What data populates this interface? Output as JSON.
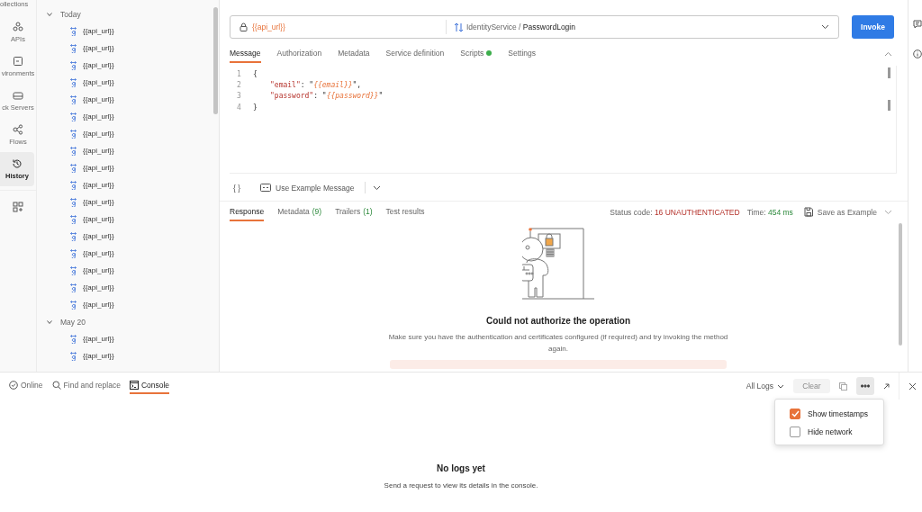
{
  "nav_rail": {
    "items": [
      {
        "label": "ollections",
        "kind": "cut",
        "selected": false
      },
      {
        "label": "APIs",
        "kind": "apis",
        "selected": false
      },
      {
        "label": "vironments",
        "kind": "environments",
        "selected": false
      },
      {
        "label": "ck Servers",
        "kind": "servers",
        "selected": false
      },
      {
        "label": "Flows",
        "kind": "flows",
        "selected": false
      },
      {
        "label": "History",
        "kind": "history",
        "selected": true
      },
      {
        "kind": "add",
        "selected": false
      }
    ]
  },
  "history": {
    "groups": [
      {
        "label": "Today",
        "expanded": true,
        "items": [
          {
            "label": "{{api_url}}"
          },
          {
            "label": "{{api_url}}"
          },
          {
            "label": "{{api_url}}"
          },
          {
            "label": "{{api_url}}"
          },
          {
            "label": "{{api_url}}"
          },
          {
            "label": "{{api_url}}"
          },
          {
            "label": "{{api_url}}"
          },
          {
            "label": "{{api_url}}"
          },
          {
            "label": "{{api_url}}"
          },
          {
            "label": "{{api_url}}"
          },
          {
            "label": "{{api_url}}"
          },
          {
            "label": "{{api_url}}"
          },
          {
            "label": "{{api_url}}"
          },
          {
            "label": "{{api_url}}"
          },
          {
            "label": "{{api_url}}"
          },
          {
            "label": "{{api_url}}"
          },
          {
            "label": "{{api_url}}"
          }
        ]
      },
      {
        "label": "May 20",
        "expanded": true,
        "items": [
          {
            "label": "{{api_url}}"
          },
          {
            "label": "{{api_url}}"
          }
        ]
      }
    ]
  },
  "request": {
    "url": "{{api_url}}",
    "service": "IdentityService",
    "separator": "/",
    "method": "PasswordLogin",
    "invoke_button": "Invoke"
  },
  "request_tabs": [
    {
      "label": "Message",
      "selected": true,
      "dot": false
    },
    {
      "label": "Authorization",
      "selected": false,
      "dot": false
    },
    {
      "label": "Metadata",
      "selected": false,
      "dot": false
    },
    {
      "label": "Service definition",
      "selected": false,
      "dot": false
    },
    {
      "label": "Scripts",
      "selected": false,
      "dot": true
    },
    {
      "label": "Settings",
      "selected": false,
      "dot": false
    }
  ],
  "editor": {
    "lines": [
      {
        "number": "1",
        "tokens": [
          {
            "kind": "punct",
            "text": "{"
          }
        ]
      },
      {
        "number": "2",
        "tokens": [
          {
            "kind": "key",
            "text": "\"email\""
          },
          {
            "kind": "punct",
            "text": ": \""
          },
          {
            "kind": "var",
            "text": "{{email}}"
          },
          {
            "kind": "punct",
            "text": "\","
          }
        ]
      },
      {
        "number": "3",
        "tokens": [
          {
            "kind": "key",
            "text": "\"password\""
          },
          {
            "kind": "punct",
            "text": ": \""
          },
          {
            "kind": "var",
            "text": "{{password}}"
          },
          {
            "kind": "punct",
            "text": "\""
          }
        ]
      },
      {
        "number": "4",
        "tokens": [
          {
            "kind": "punct",
            "text": "}"
          }
        ]
      }
    ]
  },
  "editor_toolbar": {
    "beautify_button": "{ }",
    "example_button": "Use Example Message"
  },
  "response_tabs": [
    {
      "label": "Response",
      "selected": true
    },
    {
      "label": "Metadata",
      "count": "(9)",
      "selected": false
    },
    {
      "label": "Trailers",
      "count": "(1)",
      "selected": false
    },
    {
      "label": "Test results",
      "selected": false
    }
  ],
  "status": {
    "code_label": "Status code:",
    "code": "16 UNAUTHENTICATED",
    "time_label": "Time:",
    "time": "454 ms",
    "save_button": "Save as Example"
  },
  "empty_state": {
    "title": "Could not authorize the operation",
    "message": "Make sure you have the authentication and certificates configured (if required) and try invoking the method again."
  },
  "console_bar": {
    "tabs": [
      {
        "label": "Online",
        "kind": "online",
        "selected": false
      },
      {
        "label": "Find and replace",
        "kind": "find",
        "selected": false
      },
      {
        "label": "Console",
        "kind": "console",
        "selected": true
      }
    ],
    "filter": "All Logs",
    "clear_button": "Clear",
    "clear_disabled": true,
    "menu_open": true,
    "menu": [
      {
        "label": "Show timestamps",
        "checked": true
      },
      {
        "label": "Hide network",
        "checked": false
      }
    ]
  },
  "console": {
    "title": "No logs yet",
    "message": "Send a request to view its details in the console."
  }
}
